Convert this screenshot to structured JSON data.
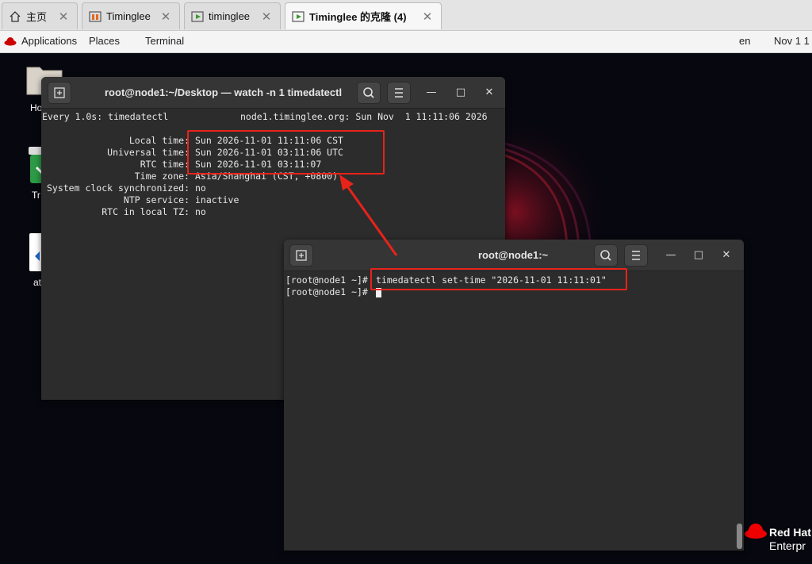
{
  "browser": {
    "tabs": [
      {
        "label": "主页",
        "icon": "home-icon",
        "close": "✕"
      },
      {
        "label": "Timinglee",
        "icon": "vm-icon",
        "close": "✕"
      },
      {
        "label": "timinglee",
        "icon": "vm-running-icon",
        "close": "✕"
      },
      {
        "label": "Timinglee 的克隆 (4)",
        "icon": "vm-running-icon",
        "close": "✕"
      }
    ]
  },
  "topbar": {
    "applications": "Applications",
    "places": "Places",
    "terminal": "Terminal",
    "lang": "en",
    "clock": "Nov 1 1"
  },
  "desktop": {
    "icons": [
      {
        "label": "Ho"
      },
      {
        "label": "Tr"
      },
      {
        "label": "at"
      }
    ],
    "brand_line1": "Red Hat",
    "brand_line2": "Enterpr"
  },
  "watch_window": {
    "title": "root@node1:~/Desktop — watch -n 1 timedatectl",
    "header_left": "Every 1.0s: timedatectl",
    "header_right": "node1.timinglee.org: Sun Nov  1 11:11:06 2026",
    "rows": [
      {
        "label": "Local time:",
        "value": "Sun 2026-11-01 11:11:06 CST"
      },
      {
        "label": "Universal time:",
        "value": "Sun 2026-11-01 03:11:06 UTC"
      },
      {
        "label": "RTC time:",
        "value": "Sun 2026-11-01 03:11:07"
      },
      {
        "label": "Time zone:",
        "value": "Asia/Shanghai (CST, +0800)"
      },
      {
        "label": "System clock synchronized:",
        "value": "no"
      },
      {
        "label": "NTP service:",
        "value": "inactive"
      },
      {
        "label": "RTC in local TZ:",
        "value": "no"
      }
    ]
  },
  "shell_window": {
    "title": "root@node1:~",
    "prompt": "[root@node1 ~]#",
    "command": "timedatectl set-time \"2026-11-01 11:11:01\"",
    "prompt2": "[root@node1 ~]#"
  },
  "colors": {
    "highlight": "#e8231a",
    "terminal_bg": "#2c2c2c"
  }
}
